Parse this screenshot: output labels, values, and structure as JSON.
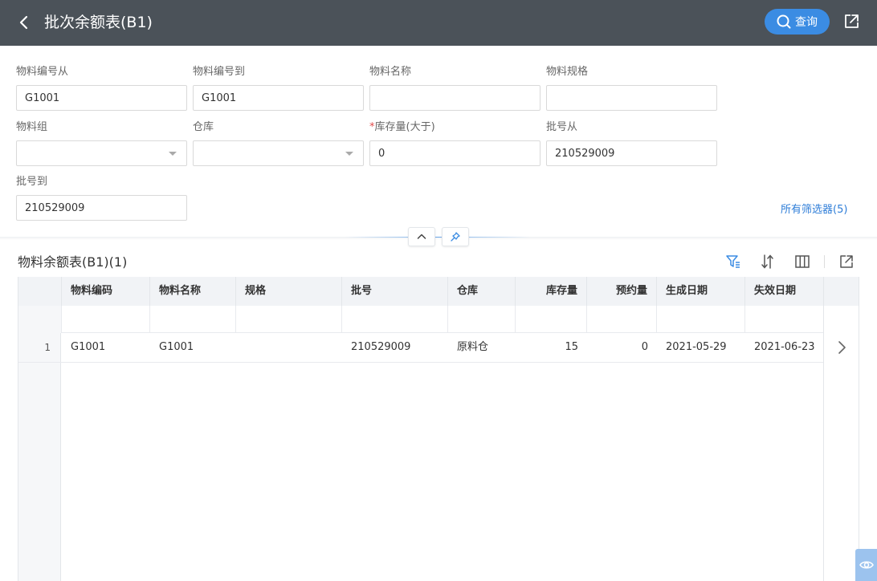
{
  "header": {
    "title": "批次余额表(B1)",
    "query_label": "查询"
  },
  "filters": {
    "material_code_from": {
      "label": "物料编号从",
      "value": "G1001"
    },
    "material_code_to": {
      "label": "物料编号到",
      "value": "G1001"
    },
    "material_name": {
      "label": "物料名称",
      "value": ""
    },
    "material_spec": {
      "label": "物料规格",
      "value": ""
    },
    "material_group": {
      "label": "物料组",
      "value": ""
    },
    "warehouse": {
      "label": "仓库",
      "value": ""
    },
    "stock_qty_gt": {
      "required_mark": "*",
      "label": "库存量(大于)",
      "value": "0"
    },
    "batch_from": {
      "label": "批号从",
      "value": "210529009"
    },
    "batch_to": {
      "label": "批号到",
      "value": "210529009"
    },
    "all_filters_label": "所有筛选器(5)"
  },
  "grid": {
    "title": "物料余额表(B1)(1)",
    "columns": [
      "物料编码",
      "物料名称",
      "规格",
      "批号",
      "仓库",
      "库存量",
      "预约量",
      "生成日期",
      "失效日期"
    ],
    "rows": [
      {
        "index": "1",
        "material_code": "G1001",
        "material_name": "G1001",
        "spec": "",
        "batch": "210529009",
        "warehouse": "原料仓",
        "stock_qty": "15",
        "reserved_qty": "0",
        "produced_date": "2021-05-29",
        "expiry_date": "2021-06-23"
      }
    ]
  },
  "icons": {
    "back": "chevron-left-icon",
    "search": "search-icon",
    "export": "export-icon",
    "collapse": "chevron-up-icon",
    "pin": "pin-icon",
    "filter": "filter-icon",
    "sort": "sort-icon",
    "columns": "columns-icon",
    "row_open": "chevron-right-icon",
    "eye": "eye-icon"
  },
  "colors": {
    "header_bg": "#4b5259",
    "primary": "#3b8ce3",
    "link": "#2f7ed8",
    "required": "#e04a4a"
  }
}
